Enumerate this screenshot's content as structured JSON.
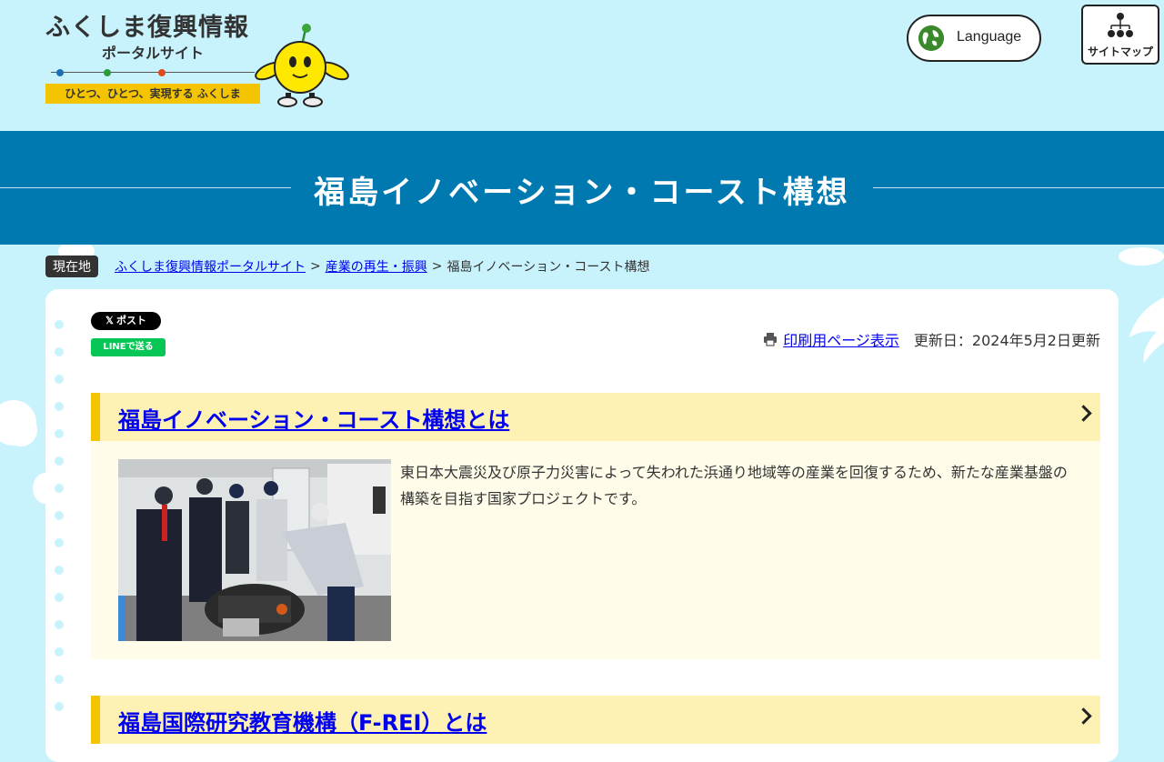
{
  "header": {
    "logo_title": "ふくしま復興情報",
    "logo_subtitle": "ポータルサイト",
    "logo_tagline": "ひとつ、ひとつ、実現する ふくしま",
    "language_label": "Language",
    "sitemap_label": "サイトマップ"
  },
  "banner": {
    "title": "福島イノベーション・コースト構想"
  },
  "breadcrumb": {
    "here_label": "現在地",
    "items": [
      {
        "label": "ふくしま復興情報ポータルサイト"
      },
      {
        "label": "産業の再生・振興"
      }
    ],
    "separator": ">",
    "current": "福島イノベーション・コースト構想"
  },
  "share": {
    "x_label": "𝕏 ポスト",
    "line_label": "LINEで送る"
  },
  "page_tools": {
    "print_label": "印刷用ページ表示",
    "updated_text": "更新日：2024年5月2日更新"
  },
  "sections": [
    {
      "heading": "福島イノベーション・コースト構想とは",
      "text": "東日本大震災及び原子力災害によって失われた浜通り地域等の産業を回復するため、新たな産業基盤の構築を目指す国家プロジェクトです。"
    },
    {
      "heading": "福島国際研究教育機構（F-REI）とは"
    }
  ],
  "colors": {
    "background": "#c9f3fc",
    "banner": "#0079b0",
    "section_accent": "#f5c400",
    "section_head": "#fdf1b3",
    "line_green": "#06c755"
  },
  "icons": [
    "globe-icon",
    "sitemap-icon",
    "printer-icon",
    "chevron-right-icon"
  ]
}
